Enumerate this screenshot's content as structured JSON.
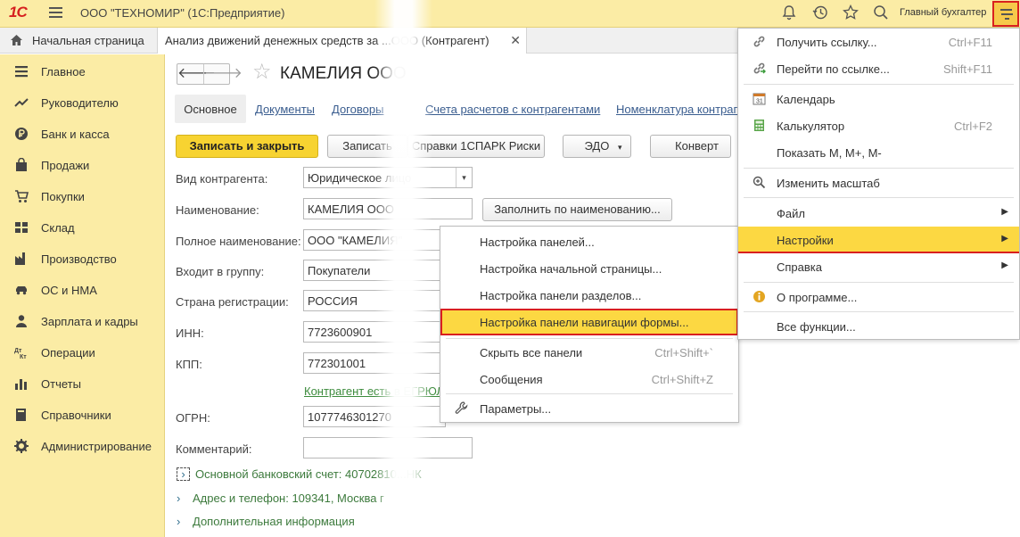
{
  "colors": {
    "header_bg": "#fbeca5",
    "accent_yellow": "#f7d331",
    "highlight": "#fcd842",
    "red_outline": "#d9201f",
    "link_blue": "#3a5d8f",
    "link_green": "#3c8b3c"
  },
  "header": {
    "logo": "1С",
    "company": "ООО \"ТЕХНОМИР\" (1С:Предприятие)",
    "user": "Главный бухгалтер",
    "icons": [
      "bell-icon",
      "history-icon",
      "star-icon",
      "search-icon",
      "menu-icon"
    ]
  },
  "tabs": {
    "home": "Начальная страница",
    "active": "Анализ движений денежных средств за ...ООО (Контрагент)"
  },
  "sidebar": {
    "items": [
      {
        "label": "Главное",
        "icon": "list-icon"
      },
      {
        "label": "Руководителю",
        "icon": "trend-icon"
      },
      {
        "label": "Банк и касса",
        "icon": "ruble-icon"
      },
      {
        "label": "Продажи",
        "icon": "bag-icon"
      },
      {
        "label": "Покупки",
        "icon": "cart-icon"
      },
      {
        "label": "Склад",
        "icon": "warehouse-icon"
      },
      {
        "label": "Производство",
        "icon": "factory-icon"
      },
      {
        "label": "ОС и НМА",
        "icon": "car-icon"
      },
      {
        "label": "Зарплата и кадры",
        "icon": "person-icon"
      },
      {
        "label": "Операции",
        "icon": "operations-icon"
      },
      {
        "label": "Отчеты",
        "icon": "chart-icon"
      },
      {
        "label": "Справочники",
        "icon": "book-icon"
      },
      {
        "label": "Администрирование",
        "icon": "gear-icon"
      }
    ]
  },
  "form": {
    "title": "КАМЕЛИЯ ООО",
    "subtabs": {
      "main": "Основное",
      "documents": "Документы",
      "contracts": "Договоры",
      "accounts": "Счета расчетов с контрагентами",
      "nomenclature": "Номенклатура контраге"
    },
    "buttons": {
      "save_close": "Записать и закрыть",
      "save": "Записать",
      "spark": "Справки 1СПАРК Риски",
      "edo": "ЭДО",
      "envelope": "Конверт",
      "fill_by_name": "Заполнить по наименованию..."
    },
    "fields": {
      "kind": {
        "label": "Вид контрагента:",
        "value": "Юридическое лицо"
      },
      "name": {
        "label": "Наименование:",
        "value": "КАМЕЛИЯ ООО"
      },
      "full_name": {
        "label": "Полное наименование:",
        "value": "ООО \"КАМЕЛИЯ\""
      },
      "group": {
        "label": "Входит в группу:",
        "value": "Покупатели"
      },
      "country": {
        "label": "Страна регистрации:",
        "value": "РОССИЯ"
      },
      "inn": {
        "label": "ИНН:",
        "value": "7723600901"
      },
      "kpp": {
        "label": "КПП:",
        "value": "772301001"
      },
      "green_link": "Контрагент есть в ЕГРЮЛ",
      "ogrn": {
        "label": "ОГРН:",
        "value": "1077746301270"
      },
      "comment": {
        "label": "Комментарий:",
        "value": ""
      }
    },
    "sections": {
      "bank": "Основной банковский счет: 40702810...НК",
      "address": "Адрес и телефон: 109341, Москва г",
      "extra": "Дополнительная информация"
    }
  },
  "submenu": {
    "items": [
      {
        "label": "Настройка панелей...",
        "shortcut": ""
      },
      {
        "label": "Настройка начальной страницы...",
        "shortcut": ""
      },
      {
        "label": "Настройка панели разделов...",
        "shortcut": ""
      },
      {
        "label": "Настройка панели навигации формы...",
        "shortcut": ""
      },
      {
        "label": "Скрыть все панели",
        "shortcut": "Ctrl+Shift+`"
      },
      {
        "label": "Сообщения",
        "shortcut": "Ctrl+Shift+Z"
      },
      {
        "label": "Параметры...",
        "shortcut": ""
      }
    ]
  },
  "mainmenu": {
    "items": [
      {
        "label": "Получить ссылку...",
        "shortcut": "Ctrl+F11"
      },
      {
        "label": "Перейти по ссылке...",
        "shortcut": "Shift+F11"
      },
      {
        "label": "Календарь",
        "shortcut": ""
      },
      {
        "label": "Калькулятор",
        "shortcut": "Ctrl+F2"
      },
      {
        "label": "Показать М, М+, М-",
        "shortcut": ""
      },
      {
        "label": "Изменить масштаб",
        "shortcut": ""
      },
      {
        "label": "Файл",
        "shortcut": ""
      },
      {
        "label": "Настройки",
        "shortcut": ""
      },
      {
        "label": "Справка",
        "shortcut": ""
      },
      {
        "label": "О программе...",
        "shortcut": ""
      },
      {
        "label": "Все функции...",
        "shortcut": ""
      }
    ]
  }
}
